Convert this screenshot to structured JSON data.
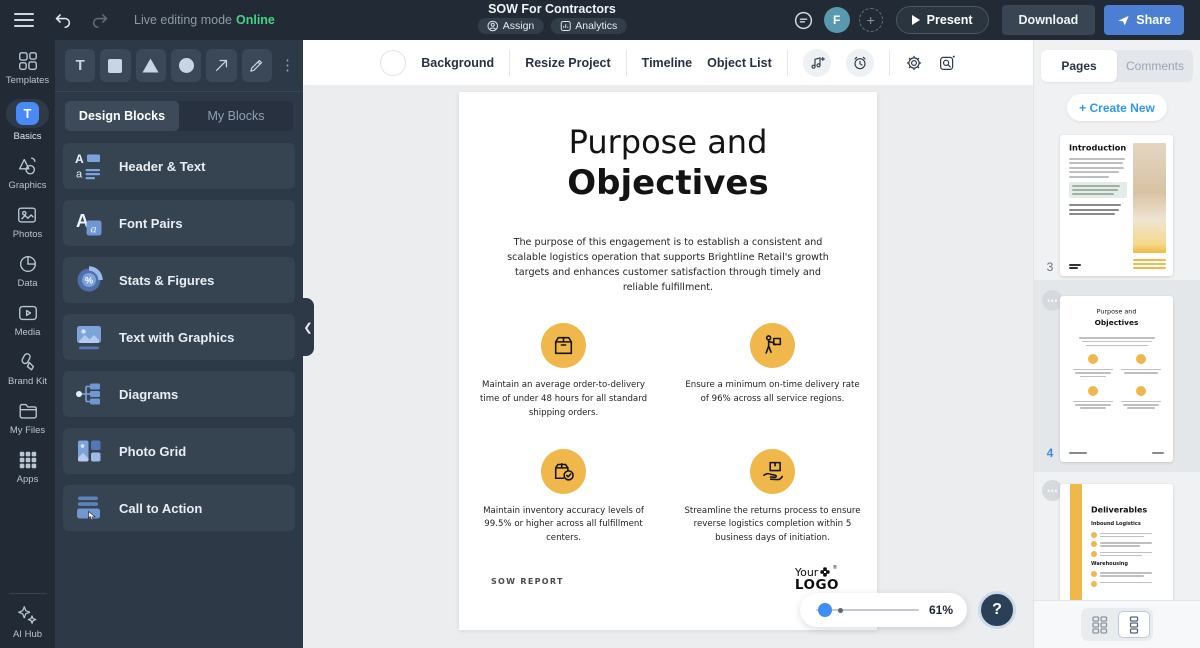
{
  "topbar": {
    "live_editing_label": "Live editing mode",
    "online_status": "Online",
    "title": "SOW For Contractors",
    "assign_label": "Assign",
    "analytics_label": "Analytics",
    "avatar_initial": "F",
    "present_label": "Present",
    "download_label": "Download",
    "share_label": "Share"
  },
  "sidebar": {
    "items": [
      {
        "label": "Templates",
        "icon": "templates-grid-icon"
      },
      {
        "label": "Basics",
        "icon": "text-basics-icon",
        "active": true
      },
      {
        "label": "Graphics",
        "icon": "shapes-icon"
      },
      {
        "label": "Photos",
        "icon": "photo-icon"
      },
      {
        "label": "Data",
        "icon": "pie-chart-icon"
      },
      {
        "label": "Media",
        "icon": "video-icon"
      },
      {
        "label": "Brand Kit",
        "icon": "brand-pen-icon"
      },
      {
        "label": "My Files",
        "icon": "folder-icon"
      },
      {
        "label": "Apps",
        "icon": "apps-grid-icon"
      }
    ],
    "ai_hub": {
      "label": "AI Hub",
      "icon": "sparkles-icon"
    }
  },
  "blocks_panel": {
    "tabs": [
      {
        "label": "Design Blocks",
        "active": true
      },
      {
        "label": "My Blocks",
        "active": false
      }
    ],
    "blocks": [
      {
        "label": "Header & Text",
        "icon": "header-text-icon"
      },
      {
        "label": "Font Pairs",
        "icon": "font-pairs-icon"
      },
      {
        "label": "Stats & Figures",
        "icon": "stats-figures-icon"
      },
      {
        "label": "Text with Graphics",
        "icon": "text-graphics-icon"
      },
      {
        "label": "Diagrams",
        "icon": "diagrams-icon"
      },
      {
        "label": "Photo Grid",
        "icon": "photo-grid-icon"
      },
      {
        "label": "Call to Action",
        "icon": "call-to-action-icon"
      }
    ]
  },
  "canvas_toolbar": {
    "background_label": "Background",
    "resize_label": "Resize Project",
    "timeline_label": "Timeline",
    "object_list_label": "Object List"
  },
  "page": {
    "title_line1": "Purpose and",
    "title_line2": "Objectives",
    "intro_text": "The purpose of this engagement is to establish a consistent and scalable logistics operation that supports Brightline Retail's growth targets and enhances customer satisfaction through timely and reliable fulfillment.",
    "objectives": [
      {
        "icon": "package-icon",
        "text": "Maintain an average order-to-delivery time of under 48 hours for all standard shipping orders."
      },
      {
        "icon": "courier-delivery-icon",
        "text": "Ensure a minimum on-time delivery rate of 96% across all service regions."
      },
      {
        "icon": "inventory-check-icon",
        "text": "Maintain inventory accuracy levels of 99.5% or higher across all fulfillment centers."
      },
      {
        "icon": "returns-hand-box-icon",
        "text": "Streamline the returns process to ensure reverse logistics completion within 5 business days of initiation."
      }
    ],
    "footer_label": "SOW REPORT",
    "logo": {
      "line1": "Your",
      "line2": "LOGO"
    }
  },
  "zoom_control": {
    "value": "61%"
  },
  "help_button_label": "?",
  "pages_panel": {
    "tabs": [
      {
        "label": "Pages",
        "active": true
      },
      {
        "label": "Comments",
        "active": false
      }
    ],
    "create_new_label": "+ Create New",
    "thumbnails": [
      {
        "page_number": "3",
        "title": "Introduction"
      },
      {
        "page_number": "4",
        "title_line1": "Purpose and",
        "title_line2": "Objectives",
        "selected": true
      },
      {
        "title": "Deliverables",
        "sections": [
          "Inbound Logistics",
          "Warehousing"
        ]
      }
    ]
  },
  "colors": {
    "accent_blue": "#4a8af4",
    "share_blue": "#4c7fd3",
    "online_green": "#45d483",
    "brand_yellow": "#f0b84a",
    "slider_blue": "#3e8ef7",
    "page_number_blue": "#3f8be0"
  }
}
